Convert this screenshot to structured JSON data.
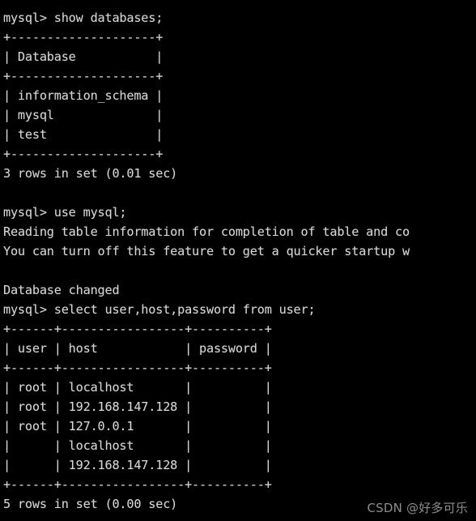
{
  "terminal": {
    "background_color": "#000000",
    "text_color": "#d6d6d6",
    "prompt": "mysql>",
    "lines": [
      "mysql> show databases;",
      "+--------------------+",
      "| Database           |",
      "+--------------------+",
      "| information_schema |",
      "| mysql              |",
      "| test               |",
      "+--------------------+",
      "3 rows in set (0.01 sec)",
      "",
      "mysql> use mysql;",
      "Reading table information for completion of table and co",
      "You can turn off this feature to get a quicker startup w",
      "",
      "Database changed",
      "mysql> select user,host,password from user;",
      "+------+-----------------+----------+",
      "| user | host            | password |",
      "+------+-----------------+----------+",
      "| root | localhost       |          |",
      "| root | 192.168.147.128 |          |",
      "| root | 127.0.0.1       |          |",
      "|      | localhost       |          |",
      "|      | 192.168.147.128 |          |",
      "+------+-----------------+----------+",
      "5 rows in set (0.00 sec)"
    ],
    "commands": [
      "show databases;",
      "use mysql;",
      "select user,host,password from user;"
    ],
    "databases_result": {
      "column": "Database",
      "rows": [
        "information_schema",
        "mysql",
        "test"
      ],
      "status": "3 rows in set (0.01 sec)"
    },
    "use_messages": [
      "Reading table information for completion of table and co",
      "You can turn off this feature to get a quicker startup w",
      "Database changed"
    ],
    "user_result": {
      "columns": [
        "user",
        "host",
        "password"
      ],
      "rows": [
        [
          "root",
          "localhost",
          ""
        ],
        [
          "root",
          "192.168.147.128",
          ""
        ],
        [
          "root",
          "127.0.0.1",
          ""
        ],
        [
          "",
          "localhost",
          ""
        ],
        [
          "",
          "192.168.147.128",
          ""
        ]
      ],
      "status": "5 rows in set (0.00 sec)"
    }
  },
  "watermark": {
    "text": "CSDN @好多可乐",
    "color": "#8d8d8d"
  }
}
